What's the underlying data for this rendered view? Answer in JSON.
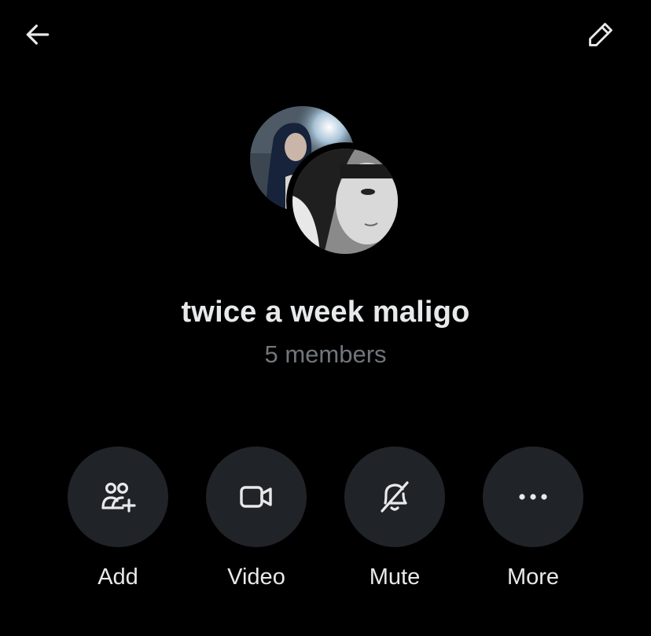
{
  "header": {
    "back_icon": "arrow-left-icon",
    "edit_icon": "pencil-icon"
  },
  "group": {
    "name": "twice a week maligo",
    "members": "5 members"
  },
  "actions": [
    {
      "label": "Add",
      "icon": "add-people-icon"
    },
    {
      "label": "Video",
      "icon": "video-camera-icon"
    },
    {
      "label": "Mute",
      "icon": "bell-off-icon"
    },
    {
      "label": "More",
      "icon": "more-dots-icon"
    }
  ],
  "colors": {
    "background": "#000000",
    "primary_text": "#e7e9ea",
    "secondary_text": "#71767b",
    "button_bg": "#202327"
  }
}
